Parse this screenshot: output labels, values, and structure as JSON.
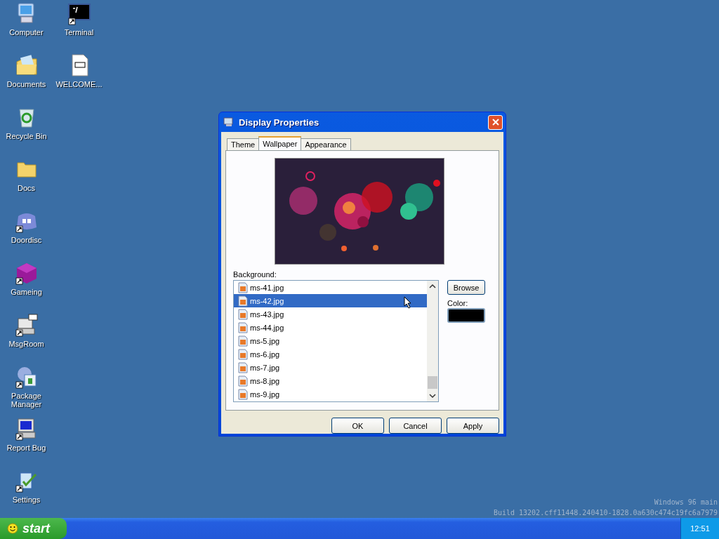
{
  "desktop_icons": [
    {
      "label": "Computer",
      "kind": "computer",
      "shortcut": false
    },
    {
      "label": "Documents",
      "kind": "documents",
      "shortcut": false
    },
    {
      "label": "Recycle Bin",
      "kind": "recycle",
      "shortcut": false
    },
    {
      "label": "Docs",
      "kind": "folder",
      "shortcut": false
    },
    {
      "label": "Doordisc",
      "kind": "chat",
      "shortcut": true
    },
    {
      "label": "Gameing",
      "kind": "cube",
      "shortcut": true
    },
    {
      "label": "MsgRoom",
      "kind": "msg",
      "shortcut": true
    },
    {
      "label": "Package Manager",
      "kind": "package",
      "shortcut": true
    },
    {
      "label": "Report Bug",
      "kind": "monitor",
      "shortcut": true
    },
    {
      "label": "Settings",
      "kind": "settings",
      "shortcut": true
    },
    {
      "label": "Terminal",
      "kind": "terminal",
      "shortcut": true
    },
    {
      "label": "WELCOME...",
      "kind": "markdown",
      "shortcut": false
    }
  ],
  "window": {
    "title": "Display Properties",
    "tabs": [
      {
        "label": "Theme",
        "selected": false
      },
      {
        "label": "Wallpaper",
        "selected": true
      },
      {
        "label": "Appearance",
        "selected": false
      }
    ],
    "background_label": "Background:",
    "files": [
      {
        "name": "ms-41.jpg",
        "selected": false
      },
      {
        "name": "ms-42.jpg",
        "selected": true
      },
      {
        "name": "ms-43.jpg",
        "selected": false
      },
      {
        "name": "ms-44.jpg",
        "selected": false
      },
      {
        "name": "ms-5.jpg",
        "selected": false
      },
      {
        "name": "ms-6.jpg",
        "selected": false
      },
      {
        "name": "ms-7.jpg",
        "selected": false
      },
      {
        "name": "ms-8.jpg",
        "selected": false
      },
      {
        "name": "ms-9.jpg",
        "selected": false
      }
    ],
    "browse_button": "Browse",
    "color_label": "Color:",
    "color": "#000000",
    "buttons": [
      "OK",
      "Cancel",
      "Apply"
    ]
  },
  "build_info": [
    "Windows 96 main",
    "Build 13202.cff11448.240410-1828.0a630c474c19fc6a7979"
  ],
  "taskbar": {
    "start": "start",
    "clock": "12:51"
  }
}
